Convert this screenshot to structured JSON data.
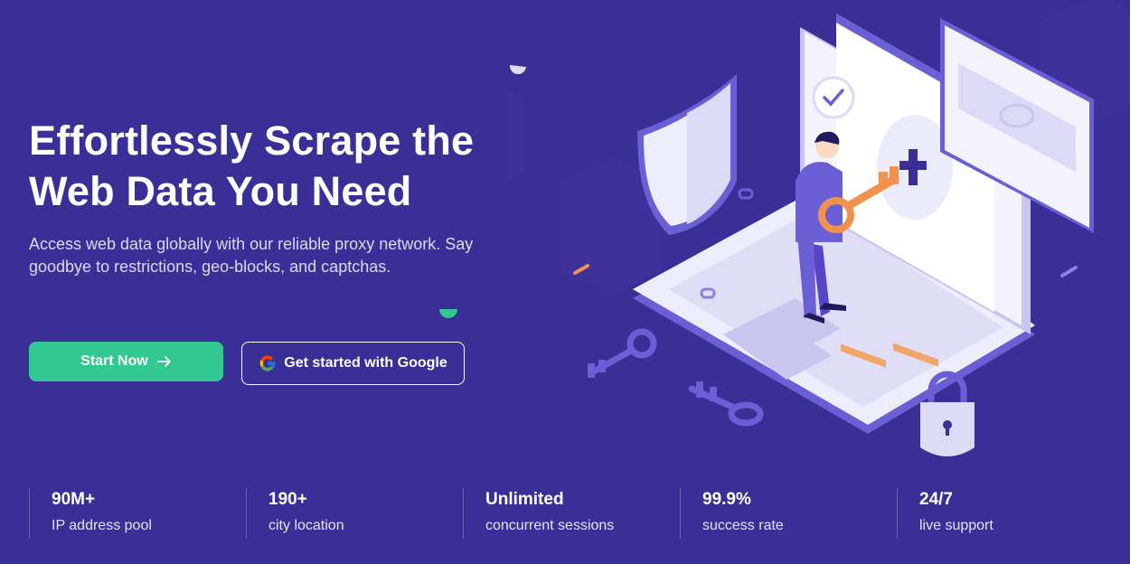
{
  "hero": {
    "title_line1": "Effortlessly Scrape the",
    "title_line2": "Web Data You Need",
    "subtitle": "Access web data globally with our reliable proxy network. Say goodbye to restrictions, geo-blocks, and captchas."
  },
  "buttons": {
    "start_label": "Start Now",
    "start_icon": "arrow-right-icon",
    "google_label": "Get started with Google",
    "google_icon": "google-icon"
  },
  "stats": [
    {
      "value": "90M+",
      "label": "IP address pool"
    },
    {
      "value": "190+",
      "label": "city location"
    },
    {
      "value": "Unlimited",
      "label": "concurrent sessions"
    },
    {
      "value": "99.9%",
      "label": "success rate"
    },
    {
      "value": "24/7",
      "label": "live support"
    }
  ],
  "colors": {
    "background": "#3a2f96",
    "accent_green": "#33c793",
    "illustration_purple": "#6b5fd6",
    "key_orange": "#f0924e"
  }
}
